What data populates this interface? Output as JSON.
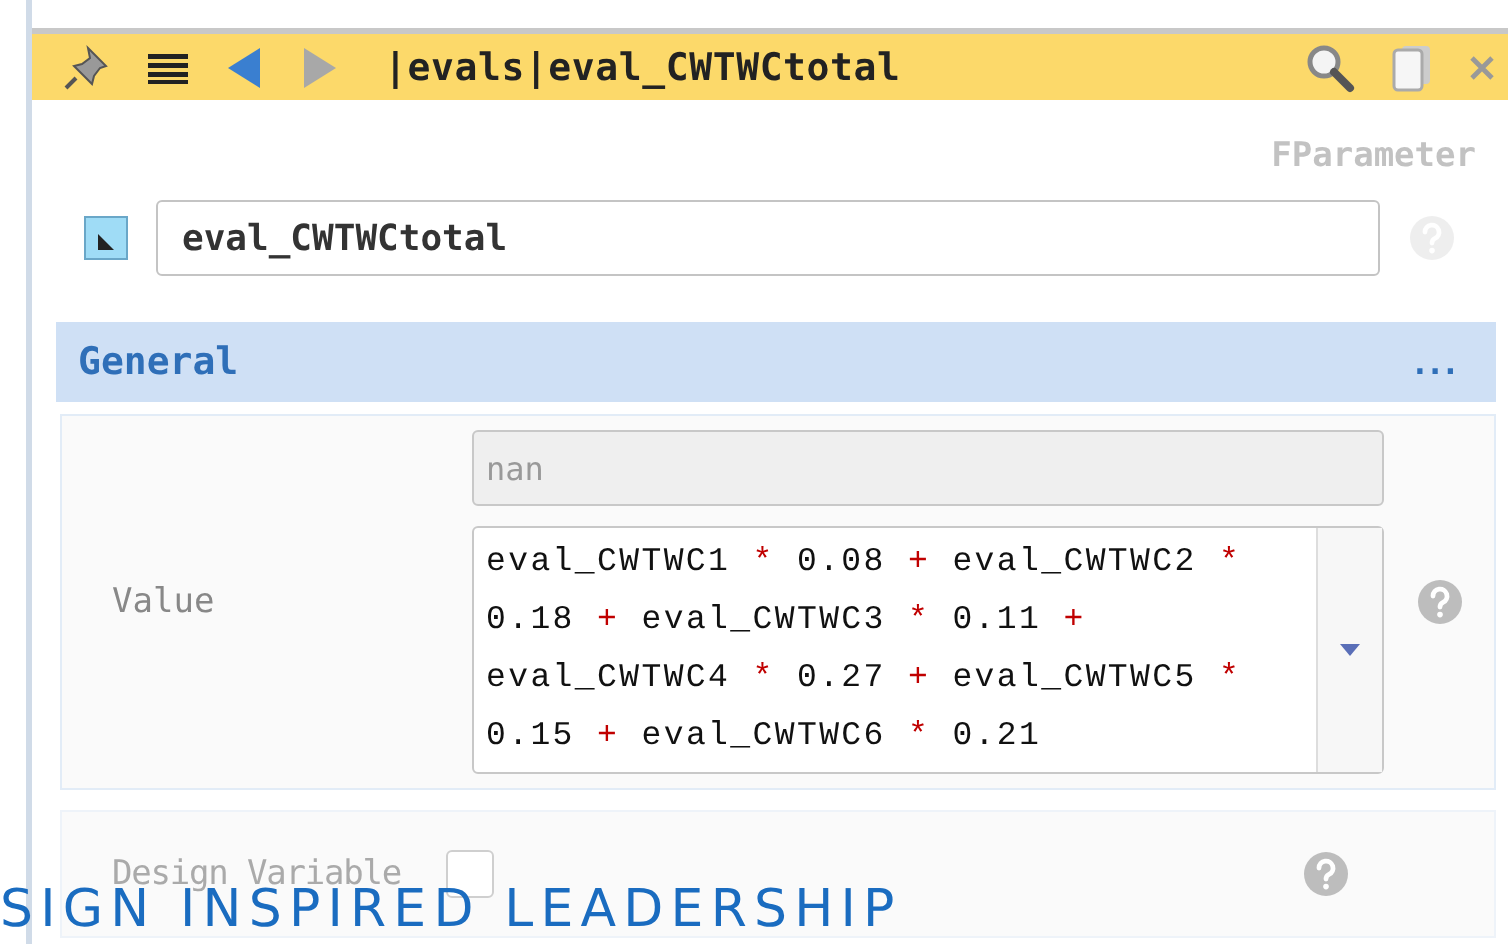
{
  "title_bar": {
    "title": "|evals|eval_CWTWCtotal",
    "back": {
      "disabled": false
    },
    "forward": {
      "disabled": true
    }
  },
  "type_label": "FParameter",
  "name_field": {
    "value": "eval_CWTWCtotal",
    "help": {
      "disabled": true
    }
  },
  "section": {
    "title": "General",
    "menu": "...",
    "value_row": {
      "label": "Value",
      "result": {
        "value": "nan",
        "disabled": true
      },
      "expression": [
        {
          "kind": "name",
          "text": "eval_CWTWC1"
        },
        {
          "kind": "op",
          "text": "*"
        },
        {
          "kind": "num",
          "text": "0.08"
        },
        {
          "kind": "op",
          "text": "+"
        },
        {
          "kind": "name",
          "text": "eval_CWTWC2"
        },
        {
          "kind": "op",
          "text": "*"
        },
        {
          "kind": "num",
          "text": "0.18"
        },
        {
          "kind": "op",
          "text": "+"
        },
        {
          "kind": "name",
          "text": "eval_CWTWC3"
        },
        {
          "kind": "op",
          "text": "*"
        },
        {
          "kind": "num",
          "text": "0.11"
        },
        {
          "kind": "op",
          "text": "+"
        },
        {
          "kind": "name",
          "text": "eval_CWTWC4"
        },
        {
          "kind": "op",
          "text": "*"
        },
        {
          "kind": "num",
          "text": "0.27"
        },
        {
          "kind": "op",
          "text": "+"
        },
        {
          "kind": "name",
          "text": "eval_CWTWC5"
        },
        {
          "kind": "op",
          "text": "*"
        },
        {
          "kind": "num",
          "text": "0.15"
        },
        {
          "kind": "op",
          "text": "+"
        },
        {
          "kind": "name",
          "text": "eval_CWTWC6"
        },
        {
          "kind": "op",
          "text": "*"
        },
        {
          "kind": "num",
          "text": "0.21"
        }
      ],
      "help": {
        "disabled": false
      }
    },
    "design_variable": {
      "label": "Design Variable",
      "checked": false,
      "disabled": true,
      "help": {
        "disabled": false
      }
    }
  },
  "banner": "SIGN INSPIRED LEADERSHIP"
}
